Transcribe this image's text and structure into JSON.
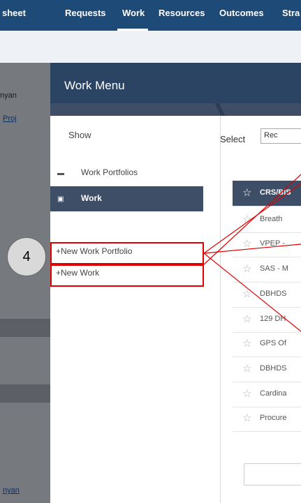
{
  "nav": {
    "items": [
      "sheet",
      "Requests",
      "Work",
      "Resources",
      "Outcomes",
      "Stra"
    ],
    "active": "Work"
  },
  "background": {
    "text_1": "nyan",
    "link_1": "Proj",
    "link_2": "nyan"
  },
  "modal": {
    "title": "Work Menu",
    "show_label": "Show",
    "options": [
      {
        "label": "Work Portfolios",
        "icon": "folder-icon",
        "active": false
      },
      {
        "label": "Work",
        "icon": "briefcase-icon",
        "active": true
      }
    ],
    "new_portfolio": "+New Work Portfolio",
    "new_work": "+New Work",
    "select_label": "Select",
    "select_value": "Rec",
    "list": [
      {
        "text": "CRS/BIS",
        "active": true
      },
      {
        "text": "Breath",
        "active": false
      },
      {
        "text": "VPEP -",
        "active": false
      },
      {
        "text": "SAS - M",
        "active": false
      },
      {
        "text": "DBHDS",
        "active": false
      },
      {
        "text": "129 DH",
        "active": false
      },
      {
        "text": "GPS Of",
        "active": false
      },
      {
        "text": "DBHDS",
        "active": false
      },
      {
        "text": "Cardina",
        "active": false
      },
      {
        "text": "Procure",
        "active": false
      }
    ]
  },
  "annotation": {
    "number": "4",
    "color": "#e00000"
  }
}
